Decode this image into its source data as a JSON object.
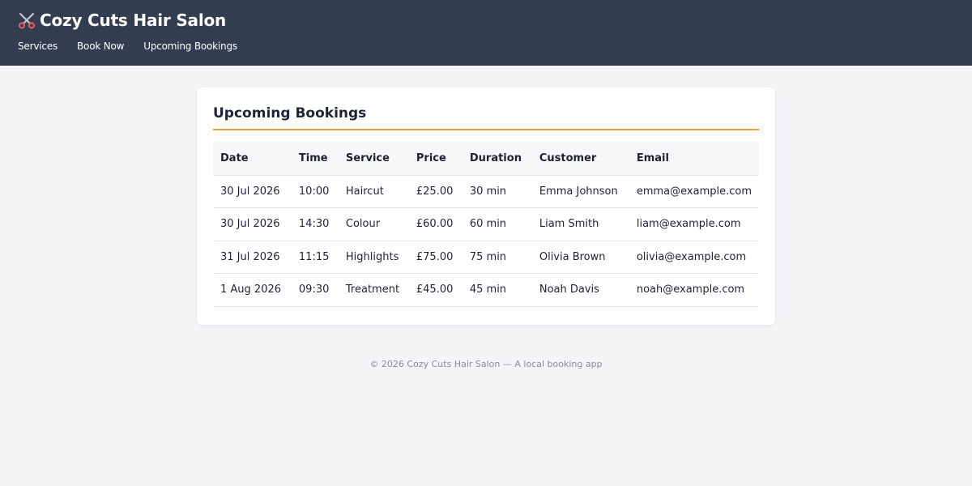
{
  "header": {
    "title": "Cozy Cuts Hair Salon",
    "icon": "scissors-icon",
    "nav": [
      "Services",
      "Book Now",
      "Upcoming Bookings"
    ]
  },
  "main": {
    "heading": "Upcoming Bookings",
    "columns": [
      "Date",
      "Time",
      "Service",
      "Price",
      "Duration",
      "Customer",
      "Email"
    ],
    "rows": [
      [
        "30 Jul 2026",
        "10:00",
        "Haircut",
        "£25.00",
        "30 min",
        "Emma Johnson",
        "emma@example.com"
      ],
      [
        "30 Jul 2026",
        "14:30",
        "Colour",
        "£60.00",
        "60 min",
        "Liam Smith",
        "liam@example.com"
      ],
      [
        "31 Jul 2026",
        "11:15",
        "Highlights",
        "£75.00",
        "75 min",
        "Olivia Brown",
        "olivia@example.com"
      ],
      [
        "1 Aug 2026",
        "09:30",
        "Treatment",
        "£45.00",
        "45 min",
        "Noah Davis",
        "noah@example.com"
      ]
    ]
  },
  "footer": {
    "text": "© 2026 Cozy Cuts Hair Salon — A local booking app"
  },
  "colors": {
    "header_bg": "#323d4f",
    "accent": "#e0a23c",
    "page_bg": "#f5f4f7"
  }
}
